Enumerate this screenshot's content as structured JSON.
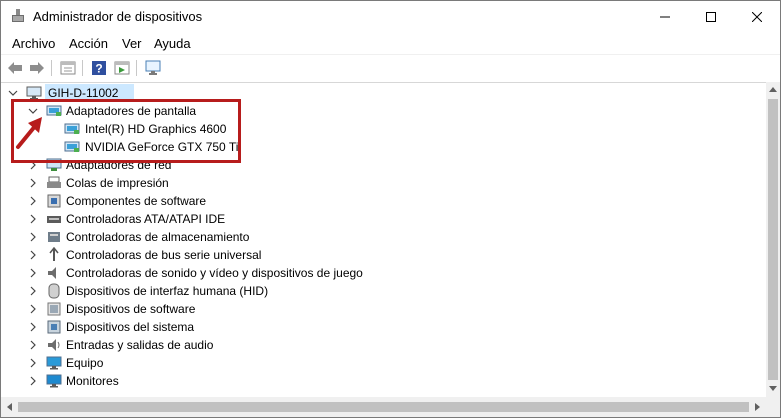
{
  "window": {
    "title": "Administrador de dispositivos"
  },
  "menu": {
    "items": [
      "Archivo",
      "Acción",
      "Ver",
      "Ayuda"
    ]
  },
  "toolbar": {
    "buttons": [
      "back-icon",
      "forward-icon",
      "properties-icon",
      "help-icon",
      "view-icon",
      "monitor-icon"
    ]
  },
  "tree": {
    "root": "GIH-D-11002",
    "categories": [
      {
        "label": "Adaptadores de pantalla",
        "expanded": true,
        "children": [
          "Intel(R) HD Graphics 4600",
          "NVIDIA GeForce GTX 750 Ti"
        ]
      },
      {
        "label": "Adaptadores de red"
      },
      {
        "label": "Colas de impresión"
      },
      {
        "label": "Componentes de software"
      },
      {
        "label": "Controladoras ATA/ATAPI IDE"
      },
      {
        "label": "Controladoras de almacenamiento"
      },
      {
        "label": "Controladoras de bus serie universal"
      },
      {
        "label": "Controladoras de sonido y vídeo y dispositivos de juego"
      },
      {
        "label": "Dispositivos de interfaz humana (HID)"
      },
      {
        "label": "Dispositivos de software"
      },
      {
        "label": "Dispositivos del sistema"
      },
      {
        "label": "Entradas y salidas de audio"
      },
      {
        "label": "Equipo"
      },
      {
        "label": "Monitores"
      }
    ]
  },
  "colors": {
    "highlight_box": "#b71c1c",
    "selection": "#cce8ff"
  }
}
